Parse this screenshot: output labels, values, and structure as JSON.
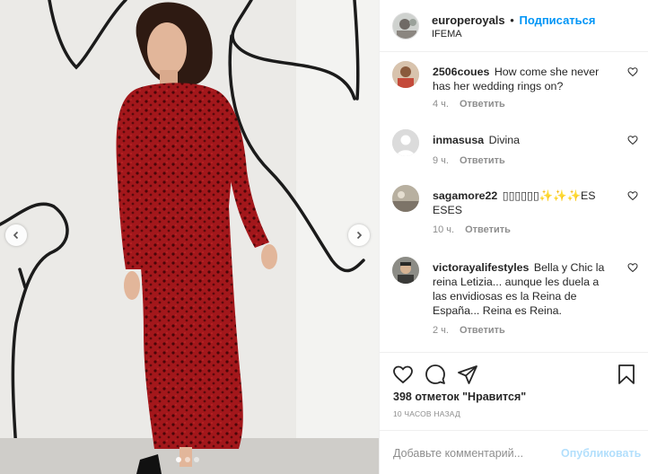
{
  "post": {
    "username": "europeroyals",
    "follow_label": "Подписаться",
    "separator": "•",
    "location": "IFEMA"
  },
  "comments": [
    {
      "username": "2506coues",
      "text": "How come she never has her wedding rings on?",
      "time": "4 ч.",
      "reply_label": "Ответить"
    },
    {
      "username": "inmasusa",
      "text": "Divina",
      "time": "9 ч.",
      "reply_label": "Ответить"
    },
    {
      "username": "sagamore22",
      "text": "▯▯▯▯▯▯✨✨✨ES ESES",
      "time": "10 ч.",
      "reply_label": "Ответить"
    },
    {
      "username": "victorayalifestyles",
      "text": "Bella y Chic la reina Letizia... aunque les duela a las envidiosas es la Reina de España... Reina es Reina.",
      "time": "2 ч.",
      "reply_label": "Ответить"
    }
  ],
  "actions": {
    "likes": "398 отметок \"Нравится\"",
    "time_ago": "10 ЧАСОВ НАЗАД"
  },
  "add_comment": {
    "placeholder": "Добавьте комментарий...",
    "publish_label": "Опубликовать"
  },
  "icons": {
    "like": "heart-icon",
    "comment": "comment-icon",
    "share": "share-icon",
    "save": "bookmark-icon",
    "prev": "chevron-left-icon",
    "next": "chevron-right-icon"
  },
  "colors": {
    "accent": "#0095f6",
    "publish_disabled": "#b2dffc",
    "secondary_text": "#8e8e8e",
    "border": "#efefef"
  }
}
